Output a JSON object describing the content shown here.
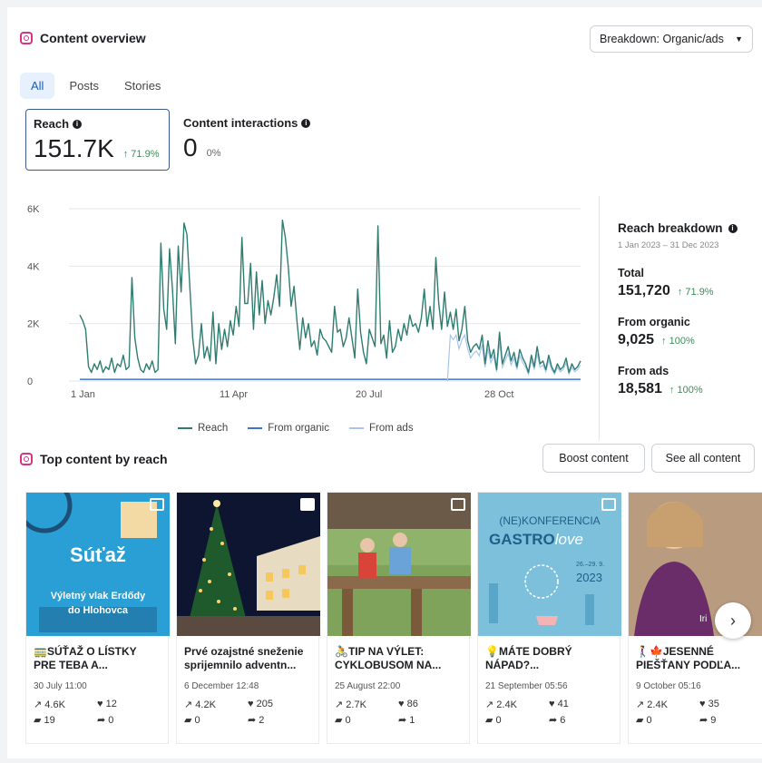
{
  "overview": {
    "title": "Content overview",
    "breakdown_label": "Breakdown: Organic/ads",
    "tabs": [
      {
        "label": "All",
        "active": true
      },
      {
        "label": "Posts"
      },
      {
        "label": "Stories"
      }
    ]
  },
  "metrics": {
    "reach": {
      "label": "Reach",
      "value": "151.7K",
      "delta": "↑ 71.9%"
    },
    "interactions": {
      "label": "Content interactions",
      "value": "0",
      "delta": "0%"
    }
  },
  "chart_data": {
    "type": "line",
    "x_ticks": [
      "1 Jan",
      "11 Apr",
      "20 Jul",
      "28 Oct"
    ],
    "y_ticks": [
      "0",
      "2K",
      "4K",
      "6K"
    ],
    "ylim": [
      0,
      6000
    ],
    "series": [
      {
        "name": "Reach",
        "color": "#2e7d70",
        "values": [
          2300,
          2100,
          1800,
          500,
          300,
          600,
          400,
          700,
          300,
          500,
          400,
          800,
          300,
          600,
          500,
          900,
          400,
          500,
          3600,
          1500,
          800,
          400,
          300,
          600,
          400,
          700,
          300,
          400,
          4800,
          2500,
          1800,
          4600,
          3200,
          1300,
          4700,
          3100,
          5500,
          5100,
          3300,
          1500,
          600,
          900,
          2000,
          800,
          1200,
          700,
          2400,
          600,
          2000,
          1100,
          1800,
          1200,
          2100,
          1600,
          2600,
          1900,
          5000,
          2700,
          2700,
          4100,
          1800,
          3800,
          2300,
          3500,
          2000,
          2800,
          2300,
          2900,
          3700,
          2600,
          5600,
          5000,
          4000,
          2600,
          3300,
          2100,
          1100,
          2200,
          1500,
          2000,
          1200,
          1400,
          900,
          1800,
          1500,
          1400,
          1200,
          1000,
          2600,
          1700,
          1800,
          1200,
          1500,
          2200,
          1500,
          800,
          3200,
          1700,
          1000,
          600,
          1800,
          1500,
          1200,
          5400,
          1300,
          1600,
          800,
          2100,
          1000,
          1200,
          1800,
          1400,
          2000,
          1600,
          2300,
          1900,
          2000,
          1700,
          2200,
          3200,
          1900,
          2600,
          1800,
          4300,
          2700,
          1800,
          3100,
          1900,
          2400,
          1800,
          2500,
          1400,
          1800,
          2600,
          1400,
          1000,
          1200,
          1300,
          1100,
          1600,
          600,
          1400,
          800,
          1100,
          400,
          1700,
          600,
          900,
          1200,
          700,
          1000,
          500,
          1100,
          800,
          600,
          300,
          900,
          500,
          1200,
          600,
          700,
          400,
          900,
          500,
          300,
          600,
          400,
          500,
          800,
          300,
          600,
          400,
          500,
          700
        ]
      },
      {
        "name": "From organic",
        "color": "#3b76d1",
        "values": []
      },
      {
        "name": "From ads",
        "color": "#a9c4ee",
        "values": []
      }
    ]
  },
  "breakdown": {
    "title": "Reach breakdown",
    "date_range": "1 Jan 2023 – 31 Dec 2023",
    "total_label": "Total",
    "total_value": "151,720",
    "total_delta": "↑ 71.9%",
    "organic_label": "From organic",
    "organic_value": "9,025",
    "organic_delta": "↑ 100%",
    "ads_label": "From ads",
    "ads_value": "18,581",
    "ads_delta": "↑ 100%"
  },
  "top": {
    "title": "Top content by reach",
    "boost_label": "Boost content",
    "see_all_label": "See all content",
    "cards": [
      {
        "title": "🚃SÚŤAŽ O LÍSTKY PRE TEBA A...",
        "date": "30 July 11:00",
        "reach": "4.6K",
        "likes": "12",
        "comments": "19",
        "shares": "0",
        "thumb_text1": "Súťaž",
        "thumb_text2": "Výletný vlak Erdődy",
        "thumb_text3": "do Hlohovca"
      },
      {
        "title": "Prvé ozajstné sneženie sprijemnilo adventn...",
        "date": "6 December 12:48",
        "reach": "4.2K",
        "likes": "205",
        "comments": "0",
        "shares": "2"
      },
      {
        "title": "🚴TIP NA VÝLET: CYKLOBUSOM NA...",
        "date": "25 August 22:00",
        "reach": "2.7K",
        "likes": "86",
        "comments": "0",
        "shares": "1"
      },
      {
        "title": "💡MÁTE DOBRÝ NÁPAD?...",
        "date": "21 September 05:56",
        "reach": "2.4K",
        "likes": "41",
        "comments": "0",
        "shares": "6",
        "thumb_text1": "(NE)KONFERENCIA",
        "thumb_text2": "GASTRO",
        "thumb_text3": "love",
        "thumb_text4": "2023",
        "thumb_text5": "26.–29. 9."
      },
      {
        "title": "🚶‍♀️🍁JESENNÉ PIEŠŤANY PODĽA...",
        "date": "9 October 05:16",
        "reach": "2.4K",
        "likes": "35",
        "comments": "0",
        "shares": "9",
        "thumb_text1": "Iri"
      }
    ]
  }
}
